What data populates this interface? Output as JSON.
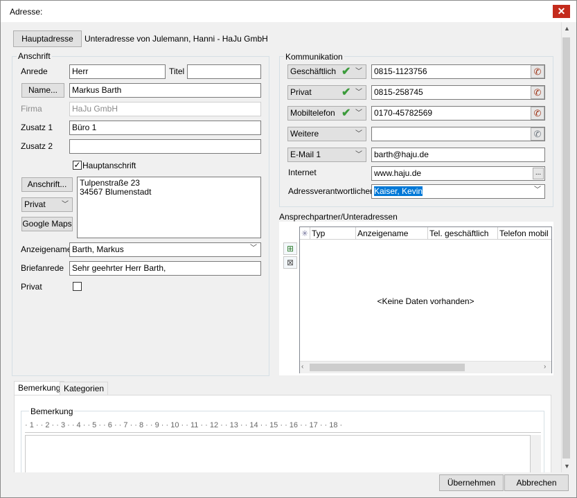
{
  "window": {
    "title": "Adresse:",
    "close_glyph": "✕"
  },
  "header": {
    "main_address_button": "Hauptadresse",
    "subtitle": "Unteradresse von Julemann, Hanni - HaJu GmbH"
  },
  "anschrift": {
    "group_label": "Anschrift",
    "anrede_label": "Anrede",
    "anrede_value": "Herr",
    "titel_label": "Titel",
    "titel_value": "",
    "name_button": "Name...",
    "name_value": "Markus Barth",
    "firma_label": "Firma",
    "firma_value": "HaJu GmbH",
    "zusatz1_label": "Zusatz 1",
    "zusatz1_value": "Büro 1",
    "zusatz2_label": "Zusatz 2",
    "zusatz2_value": "",
    "hauptanschrift_label": "Hauptanschrift",
    "hauptanschrift_checked": true,
    "anschrift_button": "Anschrift...",
    "address_type": "Privat",
    "maps_button": "Google Maps",
    "address_line1": "Tulpenstraße 23",
    "address_line2": "34567 Blumenstadt",
    "anzeigename_label": "Anzeigename",
    "anzeigename_value": "Barth, Markus",
    "briefanrede_label": "Briefanrede",
    "briefanrede_value": "Sehr geehrter Herr Barth,",
    "privat_label": "Privat",
    "privat_checked": false
  },
  "kommunikation": {
    "group_label": "Kommunikation",
    "rows": [
      {
        "type": "Geschäftlich",
        "value": "0815-1123756",
        "checked": true,
        "phone": true
      },
      {
        "type": "Privat",
        "value": "0815-258745",
        "checked": true,
        "phone": true
      },
      {
        "type": "Mobiltelefon",
        "value": "0170-45782569",
        "checked": true,
        "phone": true
      },
      {
        "type": "Weitere",
        "value": "",
        "checked": false,
        "phone": true
      },
      {
        "type": "E-Mail 1",
        "value": "barth@haju.de",
        "checked": false,
        "phone": false
      }
    ],
    "internet_label": "Internet",
    "internet_value": "www.haju.de",
    "internet_button": "...",
    "verantwortlicher_label": "Adressverantwortlicher",
    "verantwortlicher_value": "Kaiser, Kevin"
  },
  "ansprechpartner": {
    "group_label": "Ansprechpartner/Unteradressen",
    "columns": [
      "Typ",
      "Anzeigename",
      "Tel. geschäftlich",
      "Telefon mobil"
    ],
    "star": "✳",
    "empty_text": "<Keine Daten vorhanden>"
  },
  "tabs": [
    "Bemerkung",
    "Kategorien"
  ],
  "bemerkung": {
    "group_label": "Bemerkung",
    "ruler": "· 1 · · 2 · · 3 · · 4 · · 5 · · 6 · · 7 · · 8 · · 9 · · 10 · · 11 · · 12 · · 13 · · 14 · · 15 · · 16 · · 17 · · 18 ·"
  },
  "buttons": {
    "ok": "Übernehmen",
    "cancel": "Abbrechen"
  },
  "colors": {
    "check": "#3b9b3b",
    "phone": "#a0361a",
    "selection": "#0078d7",
    "close": "#c42b1c"
  }
}
